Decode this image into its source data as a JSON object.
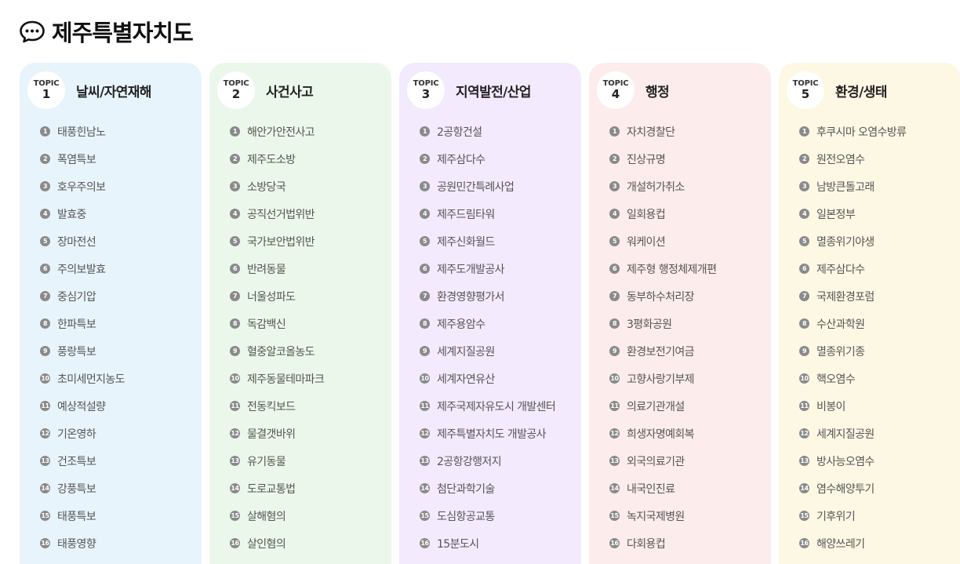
{
  "header": {
    "title": "제주특별자치도",
    "icon": "chat-bubble-icon"
  },
  "topics": [
    {
      "topic_word": "TOPIC",
      "number": "1",
      "title": "날씨/자연재해",
      "bg": "#e8f4fc",
      "items": [
        "태풍힌남노",
        "폭염특보",
        "호우주의보",
        "발효중",
        "장마전선",
        "주의보발효",
        "중심기압",
        "한파특보",
        "풍랑특보",
        "초미세먼지농도",
        "예상적설량",
        "기온영하",
        "건조특보",
        "강풍특보",
        "태풍특보",
        "태풍영향"
      ]
    },
    {
      "topic_word": "TOPIC",
      "number": "2",
      "title": "사건사고",
      "bg": "#ebf7ea",
      "items": [
        "해안가안전사고",
        "제주도소방",
        "소방당국",
        "공직선거법위반",
        "국가보안법위반",
        "반려동물",
        "너울성파도",
        "독감백신",
        "혈중알코올농도",
        "제주동물테마파크",
        "전동킥보드",
        "물결갯바위",
        "유기동물",
        "도로교통법",
        "살해혐의",
        "살인혐의"
      ]
    },
    {
      "topic_word": "TOPIC",
      "number": "3",
      "title": "지역발전/산업",
      "bg": "#f3eafd",
      "items": [
        "2공항건설",
        "제주삼다수",
        "공원민간특례사업",
        "제주드림타워",
        "제주신화월드",
        "제주도개발공사",
        "환경영향평가서",
        "제주용암수",
        "세계지질공원",
        "세계자연유산",
        "제주국제자유도시 개발센터",
        "제주특별자치도 개발공사",
        "2공항강행저지",
        "첨단과학기술",
        "도심항공교통",
        "15분도시"
      ]
    },
    {
      "topic_word": "TOPIC",
      "number": "4",
      "title": "행정",
      "bg": "#fdecec",
      "items": [
        "자치경찰단",
        "진상규명",
        "개설허가취소",
        "일회용컵",
        "워케이션",
        "제주형 행정체제개편",
        "동부하수처리장",
        "3평화공원",
        "환경보전기여금",
        "고향사랑기부제",
        "의료기관개설",
        "희생자명예회복",
        "외국의료기관",
        "내국인진료",
        "녹지국제병원",
        "다회용컵"
      ]
    },
    {
      "topic_word": "TOPIC",
      "number": "5",
      "title": "환경/생태",
      "bg": "#fdf8e4",
      "items": [
        "후쿠시마 오염수방류",
        "원전오염수",
        "남방큰돌고래",
        "일본정부",
        "멸종위기야생",
        "제주삼다수",
        "국제환경포럼",
        "수산과학원",
        "멸종위기종",
        "핵오염수",
        "비봉이",
        "세계지질공원",
        "방사능오염수",
        "염수해양투기",
        "기후위기",
        "해양쓰레기"
      ]
    }
  ]
}
